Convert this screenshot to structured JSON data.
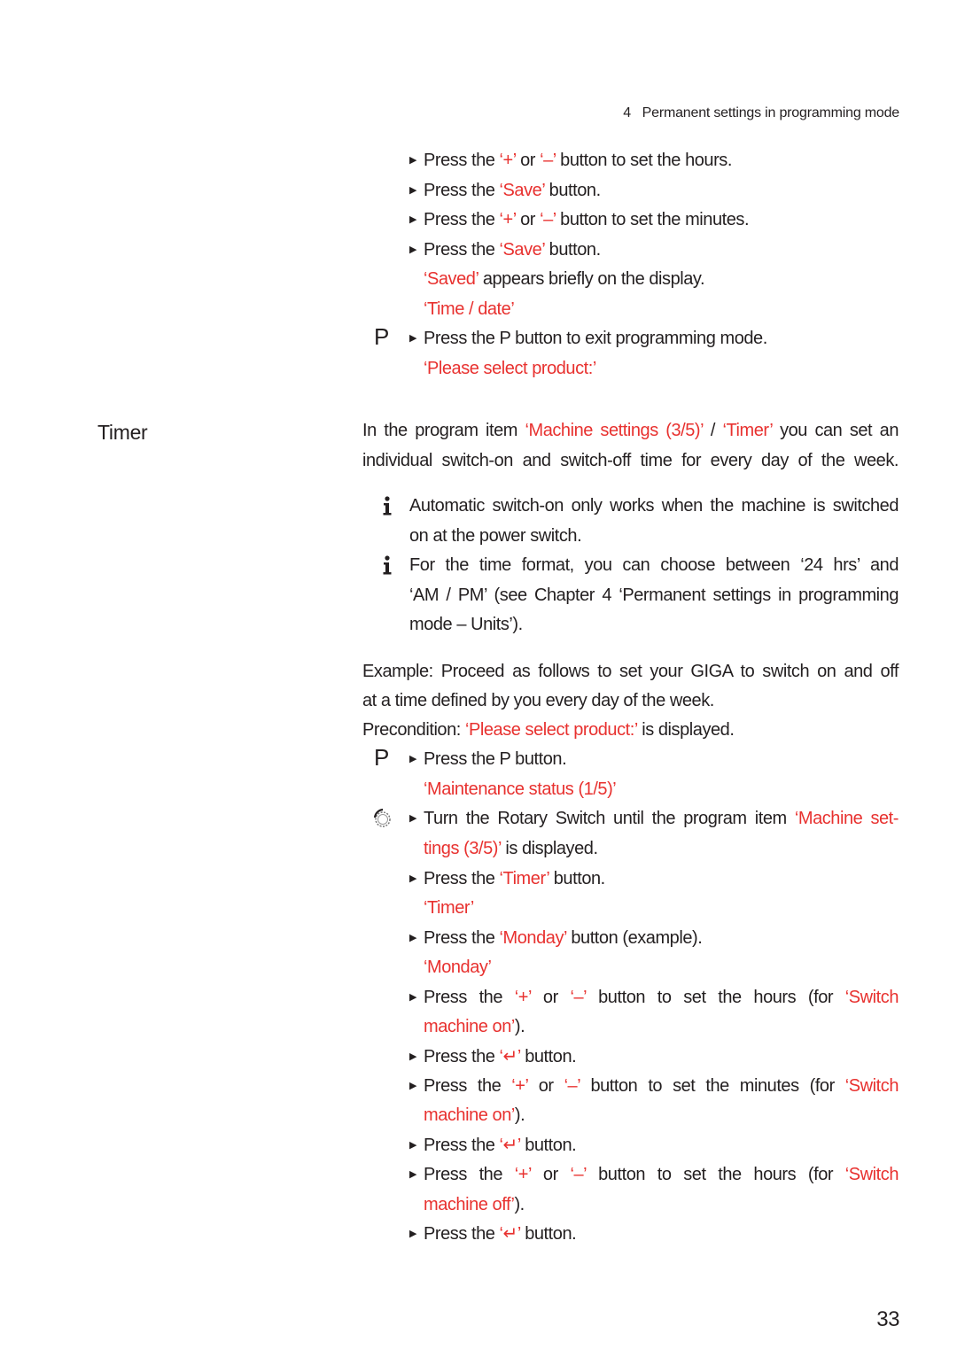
{
  "header": {
    "chapter_number": "4",
    "chapter_title": "Permanent settings in programming mode"
  },
  "section_heading": "Timer",
  "page_number": "33",
  "colors": {
    "highlight": "#e8312f",
    "text": "#231f20"
  },
  "icons": {
    "bullet": "triangle-right",
    "p_button": "P",
    "info": "info-i",
    "rotary": "rotary-switch",
    "enter": "↵"
  },
  "lines": [
    {
      "icon": "",
      "bullet": true,
      "segments": [
        {
          "t": "Press the "
        },
        {
          "t": "‘+’",
          "red": true
        },
        {
          "t": " or "
        },
        {
          "t": "‘–’",
          "red": true
        },
        {
          "t": " button to set the hours."
        }
      ]
    },
    {
      "icon": "",
      "bullet": true,
      "segments": [
        {
          "t": "Press the "
        },
        {
          "t": "‘Save’",
          "red": true
        },
        {
          "t": " button."
        }
      ]
    },
    {
      "icon": "",
      "bullet": true,
      "segments": [
        {
          "t": "Press the "
        },
        {
          "t": "‘+’",
          "red": true
        },
        {
          "t": " or "
        },
        {
          "t": "‘–’",
          "red": true
        },
        {
          "t": " button to set the minutes."
        }
      ]
    },
    {
      "icon": "",
      "bullet": true,
      "segments": [
        {
          "t": "Press the "
        },
        {
          "t": "‘Save’",
          "red": true
        },
        {
          "t": " button."
        }
      ]
    },
    {
      "icon": "",
      "bullet": false,
      "segments": [
        {
          "t": "‘Saved’",
          "red": true
        },
        {
          "t": " appears briefly on the display."
        }
      ]
    },
    {
      "icon": "",
      "bullet": false,
      "segments": [
        {
          "t": "‘Time / date’",
          "red": true
        }
      ]
    },
    {
      "icon": "P",
      "bullet": true,
      "segments": [
        {
          "t": "Press the P button to exit programming mode."
        }
      ]
    },
    {
      "icon": "",
      "bullet": false,
      "segments": [
        {
          "t": "‘Please select product:’",
          "red": true
        }
      ]
    },
    {
      "icon": "",
      "bullet": false,
      "segments": [
        {
          "t": "In the program item "
        },
        {
          "t": "‘Machine settings (3/5)’",
          "red": true
        },
        {
          "t": " / "
        },
        {
          "t": "‘Timer’",
          "red": true
        },
        {
          "t": " you can set an"
        }
      ]
    },
    {
      "icon": "",
      "bullet": false,
      "segments": [
        {
          "t": "individual switch-on and switch-off time for every day of the week."
        }
      ]
    },
    {
      "icon": "info",
      "bullet": false,
      "segments": [
        {
          "t": "Automatic switch-on only works when the machine is switched"
        }
      ]
    },
    {
      "icon": "",
      "bullet": false,
      "segments": [
        {
          "t": "on at the power switch."
        }
      ]
    },
    {
      "icon": "info",
      "bullet": false,
      "segments": [
        {
          "t": "For the time format, you can choose between ‘24 hrs’ and"
        }
      ]
    },
    {
      "icon": "",
      "bullet": false,
      "segments": [
        {
          "t": "‘AM / PM’ (see Chapter 4 ‘Permanent settings in programming"
        }
      ]
    },
    {
      "icon": "",
      "bullet": false,
      "segments": [
        {
          "t": "mode – Units’)."
        }
      ]
    },
    {
      "icon": "",
      "bullet": false,
      "segments": [
        {
          "t": "Example: Proceed as follows to set your GIGA to switch on and off"
        }
      ]
    },
    {
      "icon": "",
      "bullet": false,
      "segments": [
        {
          "t": "at a time defined by you every day of the week."
        }
      ]
    },
    {
      "icon": "",
      "bullet": false,
      "segments": [
        {
          "t": "Precondition: "
        },
        {
          "t": "‘Please select product:’",
          "red": true
        },
        {
          "t": " is displayed."
        }
      ]
    },
    {
      "icon": "P",
      "bullet": true,
      "segments": [
        {
          "t": "Press the P button."
        }
      ]
    },
    {
      "icon": "",
      "bullet": false,
      "segments": [
        {
          "t": "‘Maintenance status (1/5)’",
          "red": true
        }
      ]
    },
    {
      "icon": "rotary",
      "bullet": true,
      "segments": [
        {
          "t": "Turn the Rotary Switch until the program item "
        },
        {
          "t": "‘Machine set-",
          "red": true
        }
      ]
    },
    {
      "icon": "",
      "bullet": false,
      "segments": [
        {
          "t": "tings (3/5)’",
          "red": true
        },
        {
          "t": " is displayed."
        }
      ]
    },
    {
      "icon": "",
      "bullet": true,
      "segments": [
        {
          "t": "Press the "
        },
        {
          "t": "‘Timer’",
          "red": true
        },
        {
          "t": " button."
        }
      ]
    },
    {
      "icon": "",
      "bullet": false,
      "segments": [
        {
          "t": "‘Timer’",
          "red": true
        }
      ]
    },
    {
      "icon": "",
      "bullet": true,
      "segments": [
        {
          "t": "Press the "
        },
        {
          "t": "‘Monday’",
          "red": true
        },
        {
          "t": " button (example)."
        }
      ]
    },
    {
      "icon": "",
      "bullet": false,
      "segments": [
        {
          "t": "‘Monday’",
          "red": true
        }
      ]
    },
    {
      "icon": "",
      "bullet": true,
      "segments": [
        {
          "t": "Press the "
        },
        {
          "t": "‘+’",
          "red": true
        },
        {
          "t": " or "
        },
        {
          "t": "‘–’",
          "red": true
        },
        {
          "t": " button to set the hours (for "
        },
        {
          "t": "‘Switch",
          "red": true
        }
      ]
    },
    {
      "icon": "",
      "bullet": false,
      "segments": [
        {
          "t": "machine on’",
          "red": true
        },
        {
          "t": ")."
        }
      ]
    },
    {
      "icon": "",
      "bullet": true,
      "segments": [
        {
          "t": "Press the "
        },
        {
          "t": "‘↵’",
          "red": true
        },
        {
          "t": " button."
        }
      ]
    },
    {
      "icon": "",
      "bullet": true,
      "segments": [
        {
          "t": "Press the "
        },
        {
          "t": "‘+’",
          "red": true
        },
        {
          "t": " or "
        },
        {
          "t": "‘–’",
          "red": true
        },
        {
          "t": " button to set the minutes (for "
        },
        {
          "t": "‘Switch",
          "red": true
        }
      ]
    },
    {
      "icon": "",
      "bullet": false,
      "segments": [
        {
          "t": "machine on’",
          "red": true
        },
        {
          "t": ")."
        }
      ]
    },
    {
      "icon": "",
      "bullet": true,
      "segments": [
        {
          "t": "Press the "
        },
        {
          "t": "‘↵’",
          "red": true
        },
        {
          "t": " button."
        }
      ]
    },
    {
      "icon": "",
      "bullet": true,
      "segments": [
        {
          "t": "Press the "
        },
        {
          "t": "‘+’",
          "red": true
        },
        {
          "t": " or "
        },
        {
          "t": "‘–’",
          "red": true
        },
        {
          "t": " button to set the hours (for "
        },
        {
          "t": "‘Switch",
          "red": true
        }
      ]
    },
    {
      "icon": "",
      "bullet": false,
      "segments": [
        {
          "t": "machine off’",
          "red": true
        },
        {
          "t": ")."
        }
      ]
    },
    {
      "icon": "",
      "bullet": true,
      "segments": [
        {
          "t": "Press the "
        },
        {
          "t": "‘↵’",
          "red": true
        },
        {
          "t": " button."
        }
      ]
    }
  ]
}
